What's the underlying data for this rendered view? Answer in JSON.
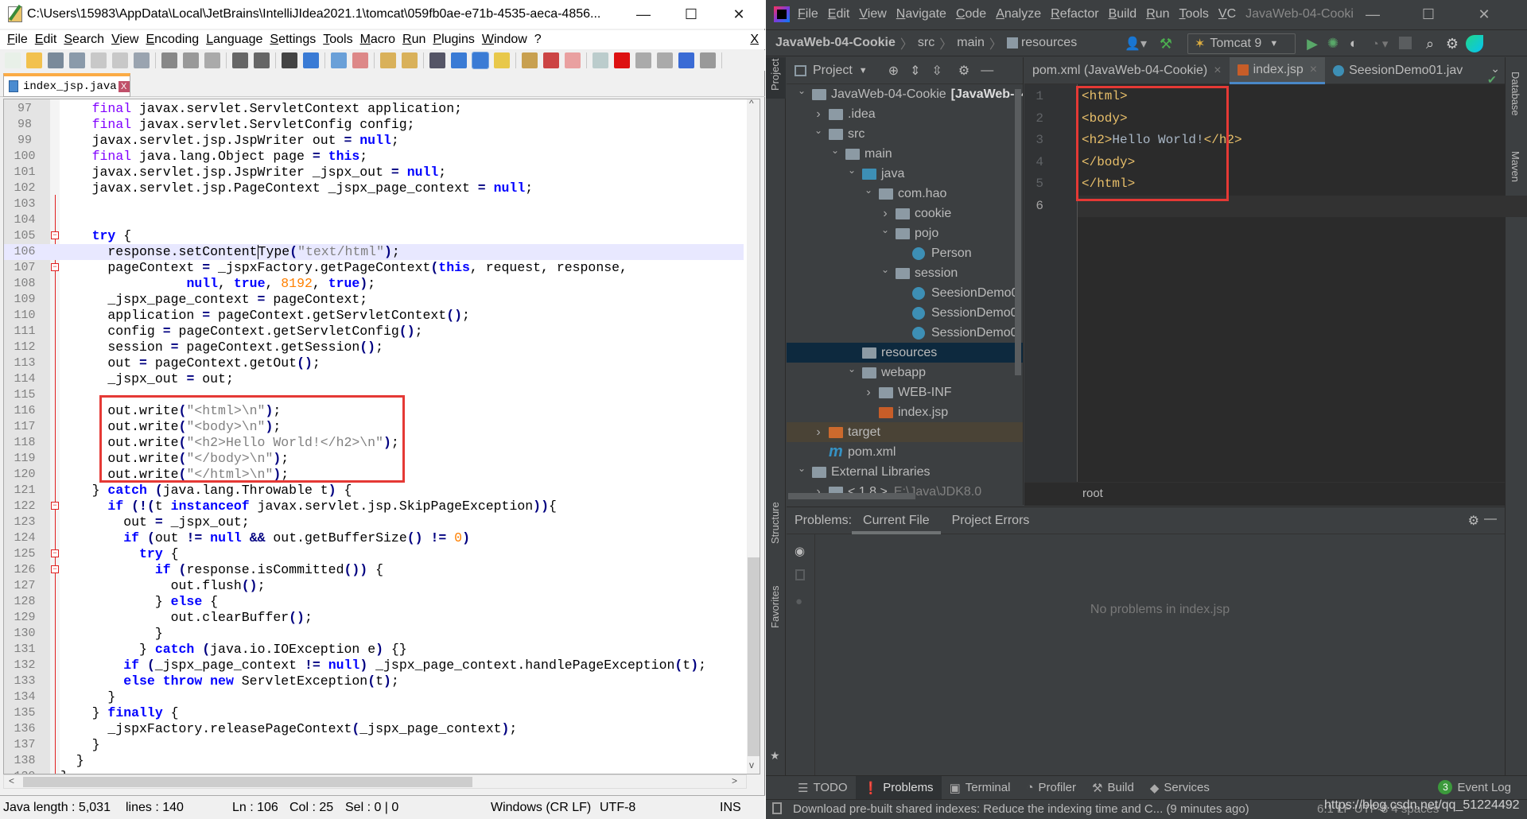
{
  "notepad": {
    "title": "C:\\Users\\15983\\AppData\\Local\\JetBrains\\IntelliJIdea2021.1\\tomcat\\059fb0ae-e71b-4535-aeca-4856...",
    "window_controls": {
      "minimize": "—",
      "maximize": "☐",
      "close": "✕"
    },
    "menu": [
      "File",
      "Edit",
      "Search",
      "View",
      "Encoding",
      "Language",
      "Settings",
      "Tools",
      "Macro",
      "Run",
      "Plugins",
      "Window",
      "?"
    ],
    "menu_close": "X",
    "toolbar": [
      "new-file",
      "open-file",
      "save",
      "save-all",
      "close",
      "close-all",
      "print",
      "cut",
      "copy",
      "paste",
      "undo",
      "redo",
      "find",
      "replace",
      "zoom-in",
      "zoom-out",
      "sync-vertical",
      "sync-horizontal",
      "word-wrap",
      "show-all-chars",
      "indent-guide",
      "udl",
      "doc-map",
      "function-list",
      "folder-workspace",
      "monitoring",
      "record-macro",
      "stop-record",
      "play-macro",
      "run-macro-multiple",
      "save-macro"
    ],
    "tab": {
      "label": "index_jsp.java",
      "close": "X"
    },
    "current_line": 106,
    "fold_markers": [
      105,
      107,
      122,
      125,
      126
    ],
    "highlight_lines": [
      116,
      120
    ],
    "lines": [
      [
        97,
        [
          "    ",
          [
            "k1",
            "final"
          ],
          " javax.servlet.ServletContext application;"
        ]
      ],
      [
        98,
        [
          "    ",
          [
            "k1",
            "final"
          ],
          " javax.servlet.ServletConfig config;"
        ]
      ],
      [
        99,
        [
          "    javax.servlet.jsp.JspWriter out ",
          [
            "o",
            "="
          ],
          " ",
          [
            "k",
            "null"
          ],
          ";"
        ]
      ],
      [
        100,
        [
          "    ",
          [
            "k1",
            "final"
          ],
          " java.lang.Object page ",
          [
            "o",
            "="
          ],
          " ",
          [
            "k",
            "this"
          ],
          ";"
        ]
      ],
      [
        101,
        [
          "    javax.servlet.jsp.JspWriter _jspx_out ",
          [
            "o",
            "="
          ],
          " ",
          [
            "k",
            "null"
          ],
          ";"
        ]
      ],
      [
        102,
        [
          "    javax.servlet.jsp.PageContext _jspx_page_context ",
          [
            "o",
            "="
          ],
          " ",
          [
            "k",
            "null"
          ],
          ";"
        ]
      ],
      [
        103,
        [
          ""
        ]
      ],
      [
        104,
        [
          ""
        ]
      ],
      [
        105,
        [
          "    ",
          [
            "k",
            "try"
          ],
          " {"
        ]
      ],
      [
        106,
        [
          "      response.setContent",
          [
            "caret",
            ""
          ],
          "Type",
          [
            "o",
            "("
          ],
          [
            "s",
            "\"text/html\""
          ],
          [
            "o",
            ")"
          ],
          ";"
        ]
      ],
      [
        107,
        [
          "      pageContext ",
          [
            "o",
            "="
          ],
          " _jspxFactory.getPageContext",
          [
            "o",
            "("
          ],
          [
            "k",
            "this"
          ],
          ", request, response,"
        ]
      ],
      [
        108,
        [
          "                ",
          [
            "k",
            "null"
          ],
          ", ",
          [
            "k",
            "true"
          ],
          ", ",
          [
            "n",
            "8192"
          ],
          ", ",
          [
            "k",
            "true"
          ],
          [
            "o",
            ")"
          ],
          ";"
        ]
      ],
      [
        109,
        [
          "      _jspx_page_context ",
          [
            "o",
            "="
          ],
          " pageContext;"
        ]
      ],
      [
        110,
        [
          "      application ",
          [
            "o",
            "="
          ],
          " pageContext.getServletContext",
          [
            "o",
            "()"
          ],
          ";"
        ]
      ],
      [
        111,
        [
          "      config ",
          [
            "o",
            "="
          ],
          " pageContext.getServletConfig",
          [
            "o",
            "()"
          ],
          ";"
        ]
      ],
      [
        112,
        [
          "      session ",
          [
            "o",
            "="
          ],
          " pageContext.getSession",
          [
            "o",
            "()"
          ],
          ";"
        ]
      ],
      [
        113,
        [
          "      out ",
          [
            "o",
            "="
          ],
          " pageContext.getOut",
          [
            "o",
            "()"
          ],
          ";"
        ]
      ],
      [
        114,
        [
          "      _jspx_out ",
          [
            "o",
            "="
          ],
          " out;"
        ]
      ],
      [
        115,
        [
          ""
        ]
      ],
      [
        116,
        [
          "      out.write",
          [
            "o",
            "("
          ],
          [
            "s",
            "\"<html>\\n\""
          ],
          [
            "o",
            ")"
          ],
          ";"
        ]
      ],
      [
        117,
        [
          "      out.write",
          [
            "o",
            "("
          ],
          [
            "s",
            "\"<body>\\n\""
          ],
          [
            "o",
            ")"
          ],
          ";"
        ]
      ],
      [
        118,
        [
          "      out.write",
          [
            "o",
            "("
          ],
          [
            "s",
            "\"<h2>Hello World!</h2>\\n\""
          ],
          [
            "o",
            ")"
          ],
          ";"
        ]
      ],
      [
        119,
        [
          "      out.write",
          [
            "o",
            "("
          ],
          [
            "s",
            "\"</body>\\n\""
          ],
          [
            "o",
            ")"
          ],
          ";"
        ]
      ],
      [
        120,
        [
          "      out.write",
          [
            "o",
            "("
          ],
          [
            "s",
            "\"</html>\\n\""
          ],
          [
            "o",
            ")"
          ],
          ";"
        ]
      ],
      [
        121,
        [
          "    } ",
          [
            "k",
            "catch"
          ],
          " ",
          [
            "o",
            "("
          ],
          "java.lang.Throwable t",
          [
            "o",
            ")"
          ],
          " {"
        ]
      ],
      [
        122,
        [
          "      ",
          [
            "k",
            "if"
          ],
          " ",
          [
            "o",
            "(!("
          ],
          "t ",
          [
            "k",
            "instanceof"
          ],
          " javax.servlet.jsp.SkipPageException",
          [
            "o",
            "))"
          ],
          "{"
        ]
      ],
      [
        123,
        [
          "        out ",
          [
            "o",
            "="
          ],
          " _jspx_out;"
        ]
      ],
      [
        124,
        [
          "        ",
          [
            "k",
            "if"
          ],
          " ",
          [
            "o",
            "("
          ],
          "out ",
          [
            "o",
            "!="
          ],
          " ",
          [
            "k",
            "null"
          ],
          " ",
          [
            "o",
            "&&"
          ],
          " out.getBufferSize",
          [
            "o",
            "()"
          ],
          " ",
          [
            "o",
            "!="
          ],
          " ",
          [
            "n",
            "0"
          ],
          [
            "o",
            ")"
          ]
        ]
      ],
      [
        125,
        [
          "          ",
          [
            "k",
            "try"
          ],
          " {"
        ]
      ],
      [
        126,
        [
          "            ",
          [
            "k",
            "if"
          ],
          " ",
          [
            "o",
            "("
          ],
          "response.isCommitted",
          [
            "o",
            "())"
          ],
          " {"
        ]
      ],
      [
        127,
        [
          "              out.flush",
          [
            "o",
            "()"
          ],
          ";"
        ]
      ],
      [
        128,
        [
          "            } ",
          [
            "k",
            "else"
          ],
          " {"
        ]
      ],
      [
        129,
        [
          "              out.clearBuffer",
          [
            "o",
            "()"
          ],
          ";"
        ]
      ],
      [
        130,
        [
          "            }"
        ]
      ],
      [
        131,
        [
          "          } ",
          [
            "k",
            "catch"
          ],
          " ",
          [
            "o",
            "("
          ],
          "java.io.IOException e",
          [
            "o",
            ")"
          ],
          " {}"
        ]
      ],
      [
        132,
        [
          "        ",
          [
            "k",
            "if"
          ],
          " ",
          [
            "o",
            "("
          ],
          "_jspx_page_context ",
          [
            "o",
            "!="
          ],
          " ",
          [
            "k",
            "null"
          ],
          [
            "o",
            ")"
          ],
          " _jspx_page_context.handlePageException",
          [
            "o",
            "("
          ],
          "t",
          [
            "o",
            ")"
          ],
          ";"
        ]
      ],
      [
        133,
        [
          "        ",
          [
            "k",
            "else"
          ],
          " ",
          [
            "k",
            "throw"
          ],
          " ",
          [
            "k",
            "new"
          ],
          " ServletException",
          [
            "o",
            "("
          ],
          "t",
          [
            "o",
            ")"
          ],
          ";"
        ]
      ],
      [
        134,
        [
          "      }"
        ]
      ],
      [
        135,
        [
          "    } ",
          [
            "k",
            "finally"
          ],
          " {"
        ]
      ],
      [
        136,
        [
          "      _jspxFactory.releasePageContext",
          [
            "o",
            "("
          ],
          "_jspx_page_context",
          [
            "o",
            ")"
          ],
          ";"
        ]
      ],
      [
        137,
        [
          "    }"
        ]
      ],
      [
        138,
        [
          "  }"
        ]
      ],
      [
        139,
        [
          "}"
        ]
      ]
    ],
    "status": {
      "lang": "Java",
      "length": "length : 5,031",
      "lines": "lines : 140",
      "ln": "Ln : 106",
      "col": "Col : 25",
      "sel": "Sel : 0 | 0",
      "eol": "Windows (CR LF)",
      "enc": "UTF-8",
      "mode": "INS"
    }
  },
  "idea": {
    "menu": [
      "File",
      "Edit",
      "View",
      "Navigate",
      "Code",
      "Analyze",
      "Refactor",
      "Build",
      "Run",
      "Tools",
      "VC"
    ],
    "project_title": "JavaWeb-04-Cooki",
    "window_controls": {
      "minimize": "—",
      "maximize": "☐",
      "close": "✕"
    },
    "breadcrumb": [
      "JavaWeb-04-Cookie",
      "src",
      "main",
      "resources"
    ],
    "run_config": "Tomcat 9",
    "project_panel": {
      "title": "Project",
      "vertical_label": "Project"
    },
    "tree": [
      {
        "depth": 0,
        "chev": "open",
        "icon": "module",
        "label": "JavaWeb-04-Cookie",
        "hint": "[JavaWeb-04"
      },
      {
        "depth": 1,
        "chev": "closed",
        "icon": "folder",
        "label": ".idea"
      },
      {
        "depth": 1,
        "chev": "open",
        "icon": "folder",
        "label": "src"
      },
      {
        "depth": 2,
        "chev": "open",
        "icon": "folder",
        "label": "main"
      },
      {
        "depth": 3,
        "chev": "open",
        "icon": "source-folder",
        "label": "java"
      },
      {
        "depth": 4,
        "chev": "open",
        "icon": "package",
        "label": "com.hao"
      },
      {
        "depth": 5,
        "chev": "closed",
        "icon": "package",
        "label": "cookie"
      },
      {
        "depth": 5,
        "chev": "open",
        "icon": "package",
        "label": "pojo"
      },
      {
        "depth": 6,
        "chev": "none",
        "icon": "class",
        "label": "Person"
      },
      {
        "depth": 5,
        "chev": "open",
        "icon": "package",
        "label": "session"
      },
      {
        "depth": 6,
        "chev": "none",
        "icon": "class",
        "label": "SeesionDemo0"
      },
      {
        "depth": 6,
        "chev": "none",
        "icon": "class",
        "label": "SessionDemo0"
      },
      {
        "depth": 6,
        "chev": "none",
        "icon": "class",
        "label": "SessionDemo0"
      },
      {
        "depth": 3,
        "chev": "none",
        "icon": "resources",
        "label": "resources",
        "selected": true
      },
      {
        "depth": 3,
        "chev": "open",
        "icon": "web-folder",
        "label": "webapp"
      },
      {
        "depth": 4,
        "chev": "closed",
        "icon": "folder",
        "label": "WEB-INF"
      },
      {
        "depth": 4,
        "chev": "none",
        "icon": "jsp",
        "label": "index.jsp"
      },
      {
        "depth": 1,
        "chev": "closed",
        "icon": "excluded-folder",
        "label": "target",
        "excluded": true
      },
      {
        "depth": 1,
        "chev": "none",
        "icon": "maven",
        "label": "pom.xml"
      },
      {
        "depth": 0,
        "chev": "open",
        "icon": "libraries",
        "label": "External Libraries"
      },
      {
        "depth": 1,
        "chev": "closed",
        "icon": "jdk",
        "label": "< 1.8 >",
        "hint": "E:\\Java\\JDK8.0"
      }
    ],
    "tabs": [
      {
        "label": "pom.xml (JavaWeb-04-Cookie)",
        "icon": "maven",
        "active": false
      },
      {
        "label": "index.jsp",
        "icon": "jsp",
        "active": true
      },
      {
        "label": "SeesionDemo01.jav",
        "icon": "class",
        "active": false
      }
    ],
    "editor_lines": [
      [
        1,
        [
          [
            "tag",
            "<html>"
          ]
        ]
      ],
      [
        2,
        [
          [
            "tag",
            "<body>"
          ]
        ]
      ],
      [
        3,
        [
          [
            "tag",
            "<h2>"
          ],
          [
            "tx",
            "Hello World!"
          ],
          [
            "tag",
            "</h2>"
          ]
        ]
      ],
      [
        4,
        [
          [
            "tag",
            "</body>"
          ]
        ]
      ],
      [
        5,
        [
          [
            "tag",
            "</html>"
          ]
        ]
      ],
      [
        6,
        []
      ]
    ],
    "current_line": 6,
    "editor_crumb": "root",
    "problems": {
      "label": "Problems:",
      "tabs": [
        "Current File",
        "Project Errors"
      ],
      "active_tab": "Current File",
      "empty": "No problems in index.jsp"
    },
    "left_stripe": [
      "Structure",
      "Favorites"
    ],
    "right_stripe": [
      "Database",
      "Maven"
    ],
    "bottom_tools": [
      {
        "label": "TODO",
        "icon": "list-icon"
      },
      {
        "label": "Problems",
        "icon": "problems-icon",
        "active": true
      },
      {
        "label": "Terminal",
        "icon": "terminal-icon"
      },
      {
        "label": "Profiler",
        "icon": "profiler-icon"
      },
      {
        "label": "Build",
        "icon": "hammer-icon"
      },
      {
        "label": "Services",
        "icon": "services-icon"
      }
    ],
    "event_log": {
      "label": "Event Log",
      "count": "3"
    },
    "status_message": "Download pre-built shared indexes: Reduce the indexing time and C... (9 minutes ago)",
    "status_right": "6:1   LF   UTF-8   4 spaces",
    "watermark": "https://blog.csdn.net/qq_51224492",
    "colors": {
      "tag": "#e8bf6a",
      "editor_bg": "#2b2b2b",
      "panel_bg": "#3c3f41",
      "selection": "#0d293e",
      "highlight_box": "#e53935",
      "npp_keyword": "#0000ff",
      "npp_type_keyword": "#8000ff",
      "npp_string": "#808080",
      "npp_number": "#ff8000"
    }
  }
}
